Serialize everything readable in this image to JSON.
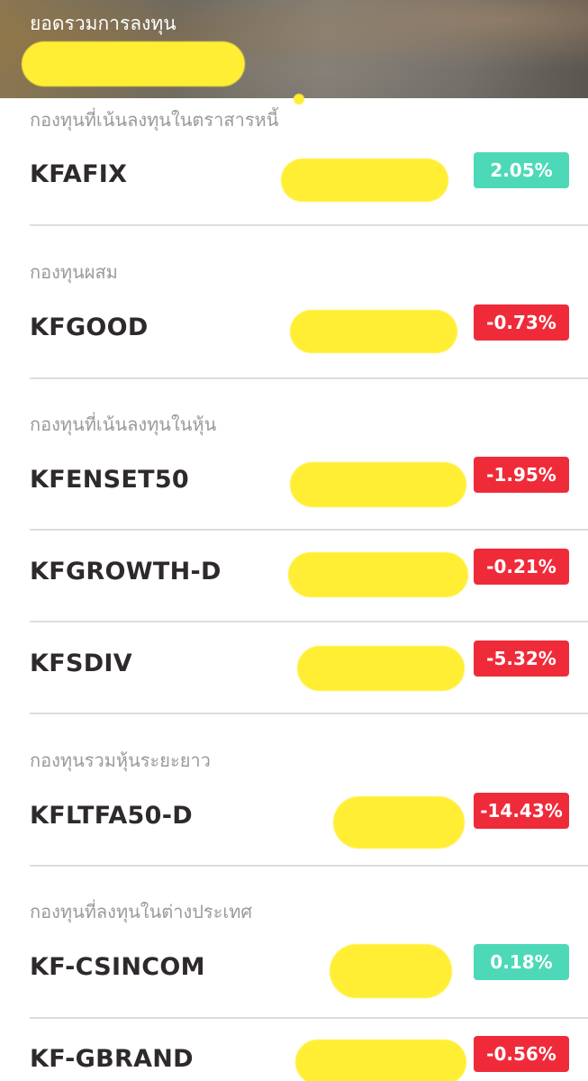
{
  "header": {
    "title": "ยอดรวมการลงทุน"
  },
  "categories": [
    "กองทุนที่เน้นลงทุนในตราสารหนี้",
    "กองทุนผสม",
    "กองทุนที่เน้นลงทุนในหุ้น",
    "กองทุนรวมหุ้นระยะยาว",
    "กองทุนที่ลงทุนในต่างประเทศ"
  ],
  "funds": [
    {
      "name": "KFAFIX",
      "change": "2.05%",
      "direction": "up"
    },
    {
      "name": "KFGOOD",
      "change": "-0.73%",
      "direction": "down"
    },
    {
      "name": "KFENSET50",
      "change": "-1.95%",
      "direction": "down"
    },
    {
      "name": "KFGROWTH-D",
      "change": "-0.21%",
      "direction": "down"
    },
    {
      "name": "KFSDIV",
      "change": "-5.32%",
      "direction": "down"
    },
    {
      "name": "KFLTFA50-D",
      "change": "-14.43%",
      "direction": "down"
    },
    {
      "name": "KF-CSINCOM",
      "change": "0.18%",
      "direction": "up"
    },
    {
      "name": "KF-GBRAND",
      "change": "-0.56%",
      "direction": "down"
    }
  ],
  "colors": {
    "positive": "#4dd9b8",
    "negative": "#ef2b3a",
    "redaction": "#ffee33"
  }
}
